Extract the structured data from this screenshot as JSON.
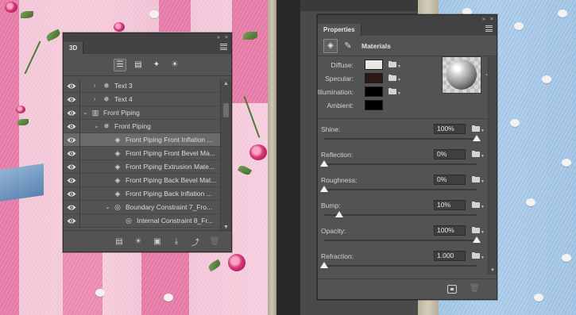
{
  "panel_3d": {
    "title": "3D",
    "collapse_glyph": "»",
    "close_glyph": "×",
    "filter_buttons": [
      {
        "name": "whole-scene-filter-icon",
        "glyph": "☰",
        "active": true
      },
      {
        "name": "meshes-filter-icon",
        "glyph": "▤"
      },
      {
        "name": "materials-filter-icon",
        "glyph": "✦"
      },
      {
        "name": "lights-filter-icon",
        "glyph": "☀"
      }
    ],
    "tree": [
      {
        "label": "Text 3",
        "indent": 1,
        "twisty": "›",
        "icon": "✵",
        "eye": true
      },
      {
        "label": "Text 4",
        "indent": 1,
        "twisty": "›",
        "icon": "✵",
        "eye": true
      },
      {
        "label": "Front Piping",
        "indent": 0,
        "twisty": "⌄",
        "icon": "▥",
        "eye": true
      },
      {
        "label": "Front Piping",
        "indent": 1,
        "twisty": "⌄",
        "icon": "✵",
        "eye": true
      },
      {
        "label": "Front Piping Front Inflation ...",
        "indent": 2,
        "twisty": "",
        "icon": "◈",
        "eye": true,
        "selected": true
      },
      {
        "label": "Front Piping Front Bevel Ma...",
        "indent": 2,
        "twisty": "",
        "icon": "◈",
        "eye": true
      },
      {
        "label": "Front Piping Extrusion Mate...",
        "indent": 2,
        "twisty": "",
        "icon": "◈",
        "eye": true
      },
      {
        "label": "Front Piping Back Bevel Mat...",
        "indent": 2,
        "twisty": "",
        "icon": "◈",
        "eye": true
      },
      {
        "label": "Front Piping Back Inflation ...",
        "indent": 2,
        "twisty": "",
        "icon": "◈",
        "eye": true
      },
      {
        "label": "Boundary Constraint 7_Fro...",
        "indent": 2,
        "twisty": "⌄",
        "icon": "◎",
        "eye": true
      },
      {
        "label": "Internal Constraint 8_Fr...",
        "indent": 3,
        "twisty": "",
        "icon": "◎",
        "eye": true
      }
    ],
    "bottom_buttons": [
      {
        "name": "mesh-from-layer-icon",
        "glyph": "▤"
      },
      {
        "name": "add-light-icon",
        "glyph": "☀"
      },
      {
        "name": "add-constraint-icon",
        "glyph": "▣"
      },
      {
        "name": "drop-to-ground-icon",
        "glyph": "⤓"
      },
      {
        "name": "render-icon",
        "glyph": "⤴"
      },
      {
        "name": "delete-icon",
        "glyph": "🗑",
        "dim": true
      }
    ]
  },
  "properties": {
    "title": "Properties",
    "section_title": "Materials",
    "mode_button_glyph": "◈",
    "brush_glyph": "✎",
    "collapse_glyph": "»",
    "close_glyph": "×",
    "texture_rows": [
      {
        "label": "Diffuse:",
        "color": "#ebe8e2",
        "folder": true
      },
      {
        "label": "Specular:",
        "color": "#2a1a12",
        "folder": true
      },
      {
        "label": "Illumination:",
        "color": "#000000",
        "folder": true
      },
      {
        "label": "Ambient:",
        "color": "#000000",
        "folder": false
      }
    ],
    "sliders": [
      {
        "label": "Shine:",
        "value": "100%",
        "fraction": 1.0
      },
      {
        "label": "Reflection:",
        "value": "0%",
        "fraction": 0.0
      },
      {
        "label": "Roughness:",
        "value": "0%",
        "fraction": 0.0
      },
      {
        "label": "Bump:",
        "value": "10%",
        "fraction": 0.1
      },
      {
        "label": "Opacity:",
        "value": "100%",
        "fraction": 1.0
      },
      {
        "label": "Refraction:",
        "value": "1.000",
        "fraction": 0.0
      }
    ]
  }
}
